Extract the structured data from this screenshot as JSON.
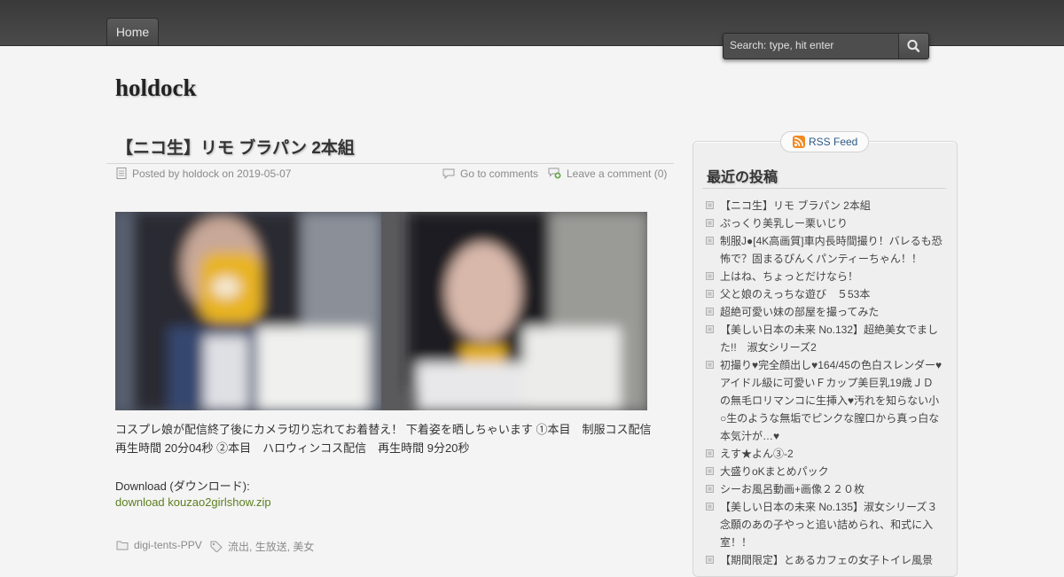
{
  "nav": {
    "home_label": "Home"
  },
  "search": {
    "placeholder": "Search: type, hit enter"
  },
  "site": {
    "title": "holdock"
  },
  "post": {
    "title": "【ニコ生】リモ ブラパン 2本組",
    "meta": {
      "posted_by": "Posted by holdock on 2019-05-07",
      "comments_link": "Go to comments",
      "leave_comment": "Leave a comment (0)"
    },
    "body_lines": [
      "コスプレ娘が配信終了後にカメラ切り忘れてお着替え！ 下着姿を晒しちゃいます ①本目　制服コス配信",
      "再生時間 20分04秒 ②本目　ハロウィンコス配信　再生時間 9分20秒"
    ],
    "download_heading": "Download (ダウンロード):",
    "download_link": "download kouzao2girlshow.zip",
    "category": "digi-tents-PPV",
    "tags": [
      "流出",
      "生放送",
      "美女"
    ],
    "tag_separator": ", "
  },
  "sidebar": {
    "rss_label": "RSS Feed",
    "widget_title": "最近の投稿",
    "recent_posts": [
      [
        "【ニコ生】リモ ブラパン 2本組"
      ],
      [
        "ぷっくり美乳しー栗いじり"
      ],
      [
        "制服J●[4K高画質]車内長時間撮り！バレるも恐",
        "怖で？固まるぴんくパンティーちゃん！！"
      ],
      [
        "上はね、ちょっとだけなら！"
      ],
      [
        "父と娘のえっちな遊び　５53本"
      ],
      [
        "超絶可愛い妹の部屋を撮ってみた"
      ],
      [
        "【美しい日本の未来 No.132】超絶美女でまし",
        "た!!　淑女シリーズ2"
      ],
      [
        "初撮り♥完全顔出し♥164/45の色白スレンダー♥",
        "アイドル級に可愛いＦカップ美巨乳19歳ＪＤ",
        "の無毛ロリマンコに生挿入♥汚れを知らない小",
        "○生のような無垢でピンクな膣口から真っ白な",
        "本気汁が…♥"
      ],
      [
        "えす★よん③-2"
      ],
      [
        "大盛りoKまとめパック"
      ],
      [
        "シーお風呂動画+画像２２０枚"
      ],
      [
        "【美しい日本の未来 No.135】淑女シリーズ３",
        "念願のあの子やっと追い詰められ、和式に入",
        "室！！"
      ],
      [
        "【期間限定】とあるカフェの女子トイレ風景"
      ]
    ]
  },
  "colors": {
    "topbar": "#434343",
    "page_bg": "#f4f4f4",
    "link_green": "#5c7f1f",
    "rss_blue": "#2e5a85"
  }
}
